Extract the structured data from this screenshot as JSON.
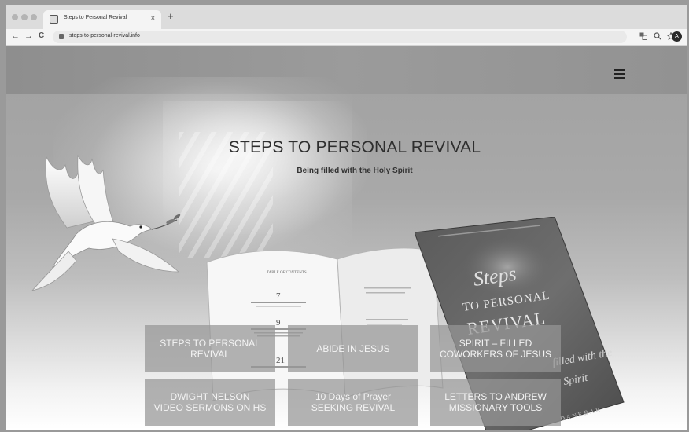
{
  "browser": {
    "tab_title": "Steps to Personal Revival",
    "tab_close": "×",
    "new_tab": "+",
    "url": "steps-to-personal-revival.info",
    "back": "←",
    "forward": "→",
    "reload": "C",
    "avatar_initial": "A",
    "toolbar_icons": [
      "translate-icon",
      "zoom-icon",
      "bookmark-star-icon"
    ]
  },
  "hero": {
    "title": "STEPS TO PERSONAL REVIVAL",
    "subtitle": "Being filled with the Holy Spirit"
  },
  "menu": {
    "icon": "hamburger-menu-icon"
  },
  "tiles": [
    {
      "line1": "STEPS TO PERSONAL",
      "line2": "REVIVAL"
    },
    {
      "line1": "ABIDE IN JESUS",
      "line2": ""
    },
    {
      "line1": "SPIRIT – FILLED",
      "line2": "COWORKERS OF JESUS"
    },
    {
      "line1": "DWIGHT NELSON",
      "line2": "VIDEO SERMONS ON HS"
    },
    {
      "line1": "10 Days of Prayer",
      "line2": "SEEKING REVIVAL"
    },
    {
      "line1": "LETTERS TO ANDREW",
      "line2": "MISSIONARY TOOLS"
    }
  ],
  "book": {
    "toc_heading": "TABLE OF CONTENTS",
    "toc_numbers": [
      "7",
      "9",
      "21"
    ],
    "cover_line1": "Steps",
    "cover_line2": "TO PERSONAL",
    "cover_line3": "REVIVAL",
    "cover_script": "filled with the",
    "cover_script2": "Spirit",
    "cover_author": "DANKBAR"
  },
  "colors": {
    "tile_bg": "#969696",
    "tile_text": "#f4f4f4",
    "title_text": "#2e2e2e"
  }
}
